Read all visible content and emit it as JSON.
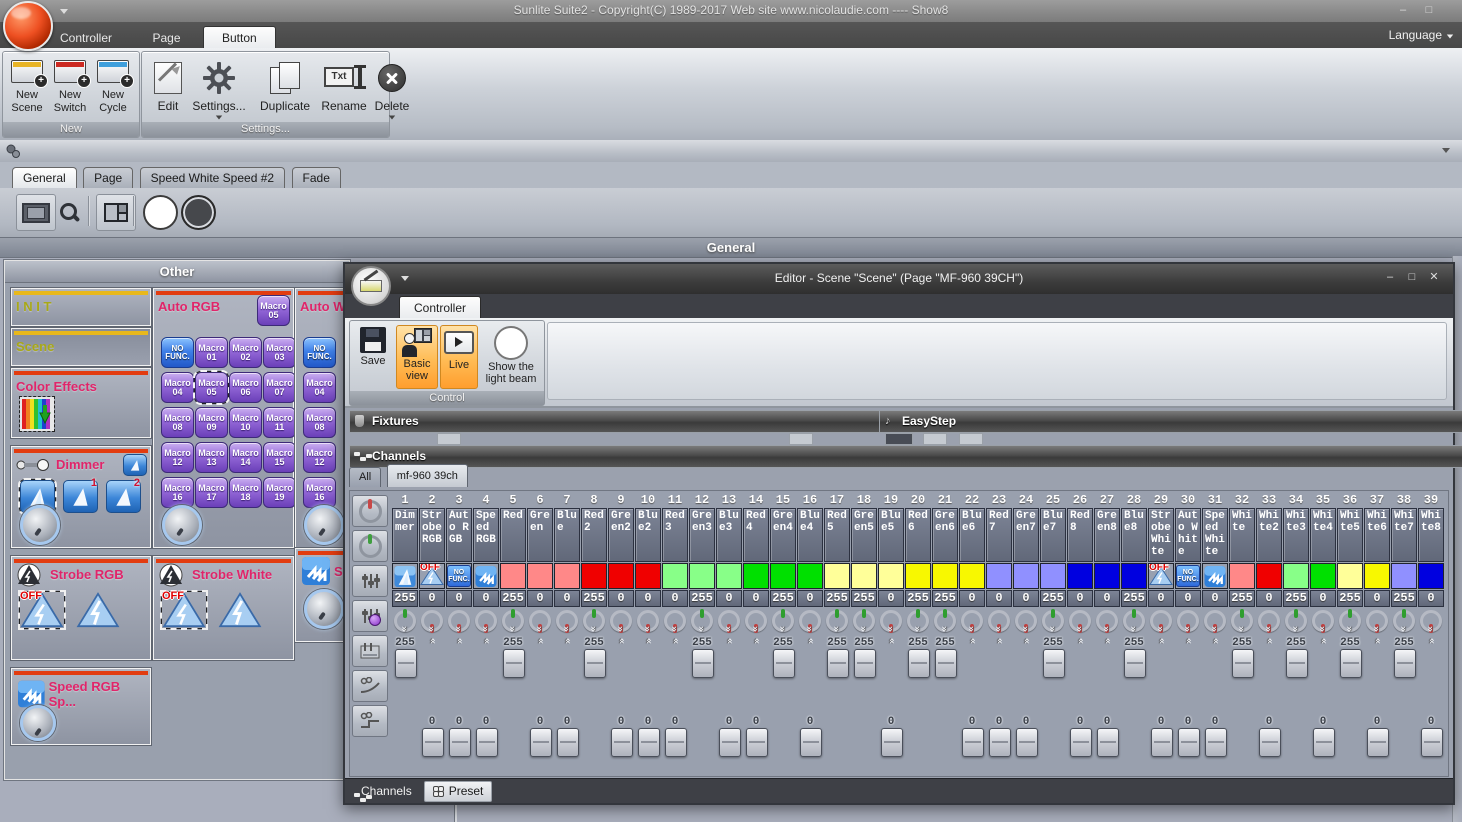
{
  "window": {
    "title": "Sunlite Suite2 - Copyright(C) 1989-2017    Web site www.nicolaudie.com ---- Show8",
    "min": "–",
    "max": "□"
  },
  "menubar": {
    "controller": "Controller",
    "page": "Page",
    "button": "Button",
    "language": "Language"
  },
  "ribbon": {
    "new_group": "New",
    "settings_group": "Settings...",
    "new_scene": [
      "New",
      "Scene"
    ],
    "new_switch": [
      "New",
      "Switch"
    ],
    "new_cycle": [
      "New",
      "Cycle"
    ],
    "edit": "Edit",
    "settings": "Settings...",
    "duplicate": "Duplicate",
    "rename": "Rename",
    "delete": "Delete",
    "rename_icon_text": "Txt",
    "accent_colors": {
      "scene": "#e8b426",
      "switch": "#cc2a22",
      "cycle": "#3f9fdc"
    }
  },
  "page_tabs": {
    "general": "General",
    "page": "Page",
    "speed": "Speed White Speed #2",
    "fade": "Fade"
  },
  "section_header": "General",
  "other": {
    "title": "Other",
    "init": "I N I T",
    "scene": "Scene",
    "color_effects": "Color Effects",
    "dimmer": "Dimmer",
    "strobe_rgb": "Strobe RGB",
    "speed_rgb": "Speed RGB Sp...",
    "auto_rgb": "Auto RGB",
    "strobe_white": "Strobe White",
    "auto_white": "Auto W",
    "speed_white_partial": "Sp",
    "badge": {
      "top": "Macro",
      "bottom": "05"
    },
    "beam1": "1",
    "beam2": "2",
    "auto_rgb_macros": [
      {
        "top": "NO",
        "bottom": "FUNC.",
        "kind": "nofunc"
      },
      {
        "top": "Macro",
        "bottom": "01"
      },
      {
        "top": "Macro",
        "bottom": "02"
      },
      {
        "top": "Macro",
        "bottom": "03"
      },
      {
        "top": "Macro",
        "bottom": "04"
      },
      {
        "top": "Macro",
        "bottom": "05",
        "selected": true
      },
      {
        "top": "Macro",
        "bottom": "06"
      },
      {
        "top": "Macro",
        "bottom": "07"
      },
      {
        "top": "Macro",
        "bottom": "08"
      },
      {
        "top": "Macro",
        "bottom": "09"
      },
      {
        "top": "Macro",
        "bottom": "10"
      },
      {
        "top": "Macro",
        "bottom": "11"
      },
      {
        "top": "Macro",
        "bottom": "12"
      },
      {
        "top": "Macro",
        "bottom": "13"
      },
      {
        "top": "Macro",
        "bottom": "14"
      },
      {
        "top": "Macro",
        "bottom": "15"
      },
      {
        "top": "Macro",
        "bottom": "16"
      },
      {
        "top": "Macro",
        "bottom": "17"
      },
      {
        "top": "Macro",
        "bottom": "18"
      },
      {
        "top": "Macro",
        "bottom": "19"
      }
    ],
    "auto_white_macros": [
      {
        "top": "NO",
        "bottom": "FUNC.",
        "kind": "nofunc"
      },
      {
        "top": "Macro",
        "bottom": "04"
      },
      {
        "top": "Macro",
        "bottom": "08"
      },
      {
        "top": "Macro",
        "bottom": "12"
      },
      {
        "top": "Macro",
        "bottom": "16"
      }
    ]
  },
  "icons": {
    "off_label": "OFF",
    "nofunc_top": "NO",
    "nofunc_bottom": "FUNC.",
    "easystep_note": "♪"
  },
  "editor": {
    "title": "Editor - Scene \"Scene\" (Page \"MF-960 39CH\")",
    "min": "–",
    "max": "□",
    "close": "✕",
    "tab": "Controller",
    "save": "Save",
    "basic_view": [
      "Basic",
      "view"
    ],
    "live": "Live",
    "show_beam": [
      "Show the",
      "light beam"
    ],
    "control_group": "Control",
    "fixtures": "Fixtures",
    "easystep": "EasyStep",
    "channels_header": "Channels",
    "tab_all": "All",
    "tab_fixture": "mf-960 39ch",
    "bottom_channels": "Channels",
    "bottom_preset": "Preset",
    "channels": [
      {
        "n": "1",
        "name": "Dimmer",
        "kind": "icon",
        "icon": "beam",
        "value": "255"
      },
      {
        "n": "2",
        "name": "Strobe RGB",
        "kind": "icon",
        "icon": "off",
        "value": "0"
      },
      {
        "n": "3",
        "name": "Auto RGB",
        "kind": "icon",
        "icon": "nofunc",
        "value": "0"
      },
      {
        "n": "4",
        "name": "Speed RGB",
        "kind": "icon",
        "icon": "speed",
        "value": "0"
      },
      {
        "n": "5",
        "name": "Red",
        "kind": "color",
        "color": "#ff8888",
        "value": "255"
      },
      {
        "n": "6",
        "name": "Green",
        "kind": "color",
        "color": "#ff8888",
        "value": "0"
      },
      {
        "n": "7",
        "name": "Blue",
        "kind": "color",
        "color": "#ff8888",
        "value": "0"
      },
      {
        "n": "8",
        "name": "Red2",
        "kind": "color",
        "color": "#f00000",
        "value": "255"
      },
      {
        "n": "9",
        "name": "Green2",
        "kind": "color",
        "color": "#f00000",
        "value": "0"
      },
      {
        "n": "10",
        "name": "Blue2",
        "kind": "color",
        "color": "#f00000",
        "value": "0"
      },
      {
        "n": "11",
        "name": "Red3",
        "kind": "color",
        "color": "#88ff88",
        "value": "0"
      },
      {
        "n": "12",
        "name": "Green3",
        "kind": "color",
        "color": "#88ff88",
        "value": "255"
      },
      {
        "n": "13",
        "name": "Blue3",
        "kind": "color",
        "color": "#88ff88",
        "value": "0"
      },
      {
        "n": "14",
        "name": "Red4",
        "kind": "color",
        "color": "#00e000",
        "value": "0"
      },
      {
        "n": "15",
        "name": "Green4",
        "kind": "color",
        "color": "#00e000",
        "value": "255"
      },
      {
        "n": "16",
        "name": "Blue4",
        "kind": "color",
        "color": "#00e000",
        "value": "0"
      },
      {
        "n": "17",
        "name": "Red5",
        "kind": "color",
        "color": "#ffff99",
        "value": "255"
      },
      {
        "n": "18",
        "name": "Green5",
        "kind": "color",
        "color": "#ffff99",
        "value": "255"
      },
      {
        "n": "19",
        "name": "Blue5",
        "kind": "color",
        "color": "#ffff99",
        "value": "0"
      },
      {
        "n": "20",
        "name": "Red6",
        "kind": "color",
        "color": "#f8f800",
        "value": "255"
      },
      {
        "n": "21",
        "name": "Green6",
        "kind": "color",
        "color": "#f8f800",
        "value": "255"
      },
      {
        "n": "22",
        "name": "Blue6",
        "kind": "color",
        "color": "#f8f800",
        "value": "0"
      },
      {
        "n": "23",
        "name": "Red7",
        "kind": "color",
        "color": "#9090ff",
        "value": "0"
      },
      {
        "n": "24",
        "name": "Green7",
        "kind": "color",
        "color": "#9090ff",
        "value": "0"
      },
      {
        "n": "25",
        "name": "Blue7",
        "kind": "color",
        "color": "#9090ff",
        "value": "255"
      },
      {
        "n": "26",
        "name": "Red8",
        "kind": "color",
        "color": "#0000e0",
        "value": "0"
      },
      {
        "n": "27",
        "name": "Green8",
        "kind": "color",
        "color": "#0000e0",
        "value": "0"
      },
      {
        "n": "28",
        "name": "Blue8",
        "kind": "color",
        "color": "#0000e0",
        "value": "255"
      },
      {
        "n": "29",
        "name": "Strobe White",
        "kind": "icon",
        "icon": "off",
        "value": "0"
      },
      {
        "n": "30",
        "name": "Auto White",
        "kind": "icon",
        "icon": "nofunc",
        "value": "0"
      },
      {
        "n": "31",
        "name": "Speed White",
        "kind": "icon",
        "icon": "speed",
        "value": "0"
      },
      {
        "n": "32",
        "name": "White",
        "kind": "color",
        "color": "#ff8888",
        "value": "255"
      },
      {
        "n": "33",
        "name": "White2",
        "kind": "color",
        "color": "#f00000",
        "value": "0"
      },
      {
        "n": "34",
        "name": "White3",
        "kind": "color",
        "color": "#88ff88",
        "value": "255"
      },
      {
        "n": "35",
        "name": "White4",
        "kind": "color",
        "color": "#00e000",
        "value": "0"
      },
      {
        "n": "36",
        "name": "White5",
        "kind": "color",
        "color": "#ffff99",
        "value": "255"
      },
      {
        "n": "37",
        "name": "White6",
        "kind": "color",
        "color": "#f8f800",
        "value": "0"
      },
      {
        "n": "38",
        "name": "White7",
        "kind": "color",
        "color": "#9090ff",
        "value": "255"
      },
      {
        "n": "39",
        "name": "White8",
        "kind": "color",
        "color": "#0000e0",
        "value": "0"
      }
    ]
  }
}
